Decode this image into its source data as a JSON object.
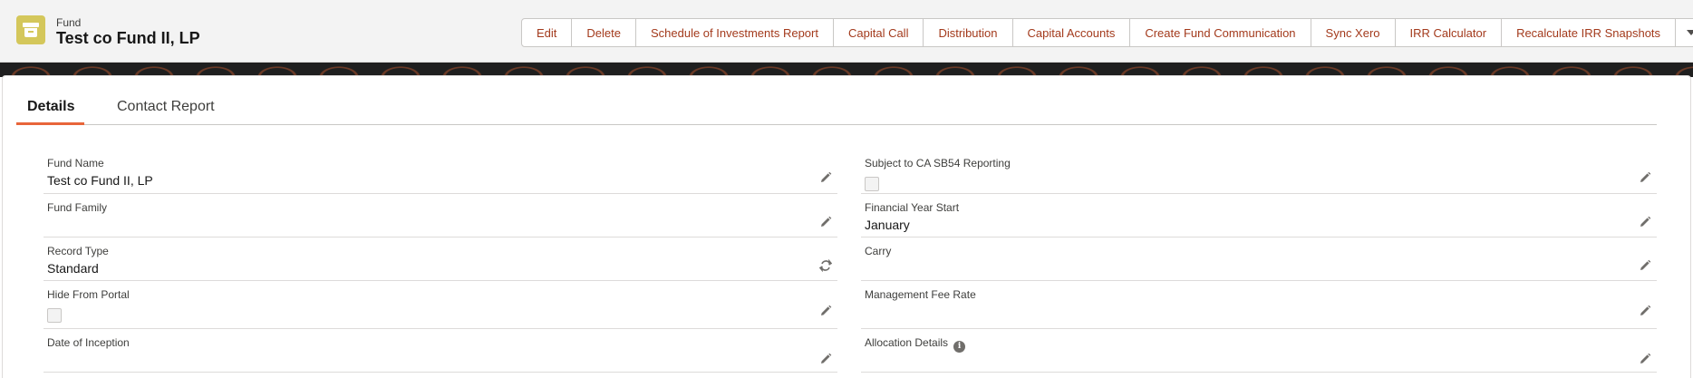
{
  "header": {
    "object_type": "Fund",
    "title": "Test co Fund II, LP",
    "icon": "archive-box-icon"
  },
  "actions": [
    {
      "label": "Edit",
      "name": "edit-button"
    },
    {
      "label": "Delete",
      "name": "delete-button"
    },
    {
      "label": "Schedule of Investments Report",
      "name": "schedule-of-investments-report-button"
    },
    {
      "label": "Capital Call",
      "name": "capital-call-button"
    },
    {
      "label": "Distribution",
      "name": "distribution-button"
    },
    {
      "label": "Capital Accounts",
      "name": "capital-accounts-button"
    },
    {
      "label": "Create Fund Communication",
      "name": "create-fund-communication-button"
    },
    {
      "label": "Sync Xero",
      "name": "sync-xero-button"
    },
    {
      "label": "IRR Calculator",
      "name": "irr-calculator-button"
    },
    {
      "label": "Recalculate IRR Snapshots",
      "name": "recalculate-irr-snapshots-button"
    }
  ],
  "tabs": {
    "details": "Details",
    "contact_report": "Contact Report"
  },
  "fields": {
    "fund_name": {
      "label": "Fund Name",
      "value": "Test co Fund II, LP"
    },
    "fund_family": {
      "label": "Fund Family",
      "value": ""
    },
    "record_type": {
      "label": "Record Type",
      "value": "Standard"
    },
    "hide_from_portal": {
      "label": "Hide From Portal",
      "checked": false
    },
    "date_of_inception": {
      "label": "Date of Inception",
      "value": ""
    },
    "subject_to_ca_sb54": {
      "label": "Subject to CA SB54 Reporting",
      "checked": false
    },
    "financial_year_start": {
      "label": "Financial Year Start",
      "value": "January"
    },
    "carry": {
      "label": "Carry",
      "value": ""
    },
    "management_fee_rate": {
      "label": "Management Fee Rate",
      "value": ""
    },
    "allocation_details": {
      "label": "Allocation Details",
      "value": ""
    }
  },
  "colors": {
    "accent": "#e8653a",
    "action_text": "#a33a1c",
    "icon_bg": "#d4c75b"
  }
}
